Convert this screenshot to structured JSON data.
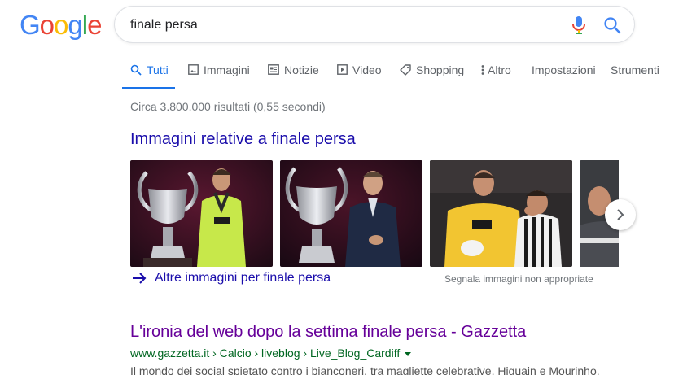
{
  "logo": {
    "letters": [
      "G",
      "o",
      "o",
      "g",
      "l",
      "e"
    ],
    "colors": [
      "#4285F4",
      "#EA4335",
      "#FBBC05",
      "#4285F4",
      "#34A853",
      "#EA4335"
    ]
  },
  "search": {
    "query": "finale persa",
    "mic_icon": "microphone-icon",
    "search_icon": "search-icon"
  },
  "tabs": [
    {
      "label": "Tutti",
      "icon": "search-icon",
      "active": true
    },
    {
      "label": "Immagini",
      "icon": "image-icon"
    },
    {
      "label": "Notizie",
      "icon": "news-icon"
    },
    {
      "label": "Video",
      "icon": "video-icon"
    },
    {
      "label": "Shopping",
      "icon": "tag-icon"
    },
    {
      "label": "Altro",
      "icon": "more-vert-icon"
    },
    {
      "label": "Impostazioni"
    },
    {
      "label": "Strumenti"
    }
  ],
  "stats": "Circa 3.800.000 risultati (0,55 secondi)",
  "images": {
    "heading": "Immagini relative a finale persa",
    "more_label": "Altre immagini per finale persa",
    "report_label": "Segnala immagini non appropriate",
    "next_icon": "chevron-right-icon"
  },
  "result": {
    "title": "L'ironia del web dopo la settima finale persa - Gazzetta",
    "url": "www.gazzetta.it › Calcio › liveblog › Live_Blog_Cardiff",
    "snippet": "Il mondo dei social spietato contro i bianconeri, tra magliette celebrative, Higuain e Mourinho."
  },
  "colors": {
    "link": "#1a0dab",
    "visited": "#660099",
    "url_green": "#006621",
    "active_tab": "#1a73e8"
  }
}
